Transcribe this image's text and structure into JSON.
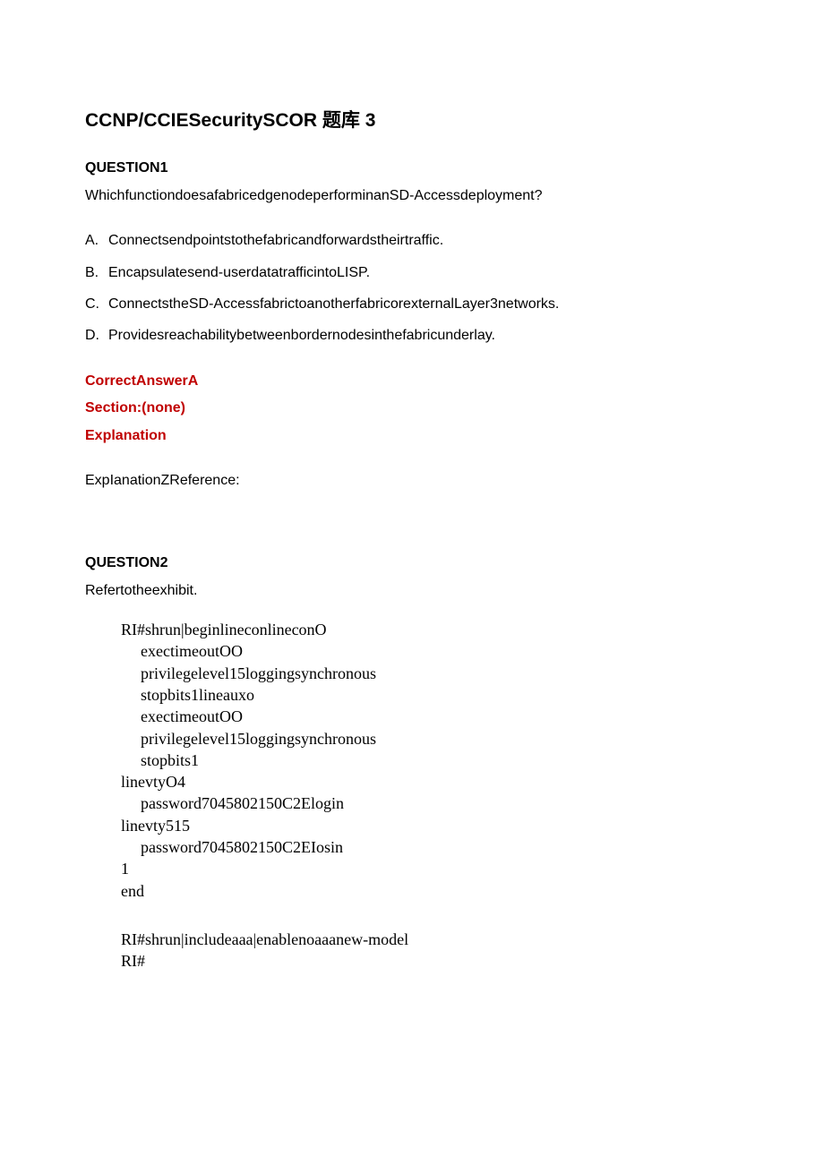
{
  "title": "CCNP/CCIESecuritySCOR 题库 3",
  "q1": {
    "heading": "QUESTION1",
    "text": "WhichfunctiondoesafabricedgenodeperforminanSD-Accessdeployment?",
    "choices": [
      {
        "letter": "A.",
        "text": "Connectsendpointstothefabricandforwardstheirtraffic."
      },
      {
        "letter": "B.",
        "text": "Encapsulatesend-userdatatrafficintoLISP."
      },
      {
        "letter": "C.",
        "text": "ConnectstheSD-AccessfabrictoanotherfabricorexternalLayer3networks."
      },
      {
        "letter": "D.",
        "text": "Providesreachabilitybetweenbordernodesinthefabricunderlay."
      }
    ],
    "answer": "CorrectAnswerA",
    "section": "Section:(none)",
    "explanation_label": "Explanation",
    "explanation_ref": "ExpIanationZReference:"
  },
  "q2": {
    "heading": "QUESTION2",
    "text": "Refertotheexhibit.",
    "exhibit": {
      "block1": [
        {
          "ind": 0,
          "text": "RI#shrun|beginlineconlineconO"
        },
        {
          "ind": 1,
          "text": "exectimeoutOO"
        },
        {
          "ind": 1,
          "text": "privilegelevel15loggingsynchronous"
        },
        {
          "ind": 1,
          "text": "stopbits1lineauxo"
        },
        {
          "ind": 1,
          "text": "exectimeoutOO"
        },
        {
          "ind": 1,
          "text": "privilegelevel15loggingsynchronous"
        },
        {
          "ind": 1,
          "text": "stopbits1"
        },
        {
          "ind": 0,
          "text": "linevtyO4"
        },
        {
          "ind": 1,
          "text": "password7045802150C2Elogin"
        },
        {
          "ind": 0,
          "text": "linevty515"
        },
        {
          "ind": 1,
          "text": "password7045802150C2EIosin"
        },
        {
          "ind": 0,
          "text": "1"
        },
        {
          "ind": 0,
          "text": "end"
        }
      ],
      "block2": [
        {
          "ind": 0,
          "text": "RI#shrun|includeaaa|enablenoaaanew-model"
        },
        {
          "ind": 0,
          "text": "RI#"
        }
      ]
    }
  }
}
